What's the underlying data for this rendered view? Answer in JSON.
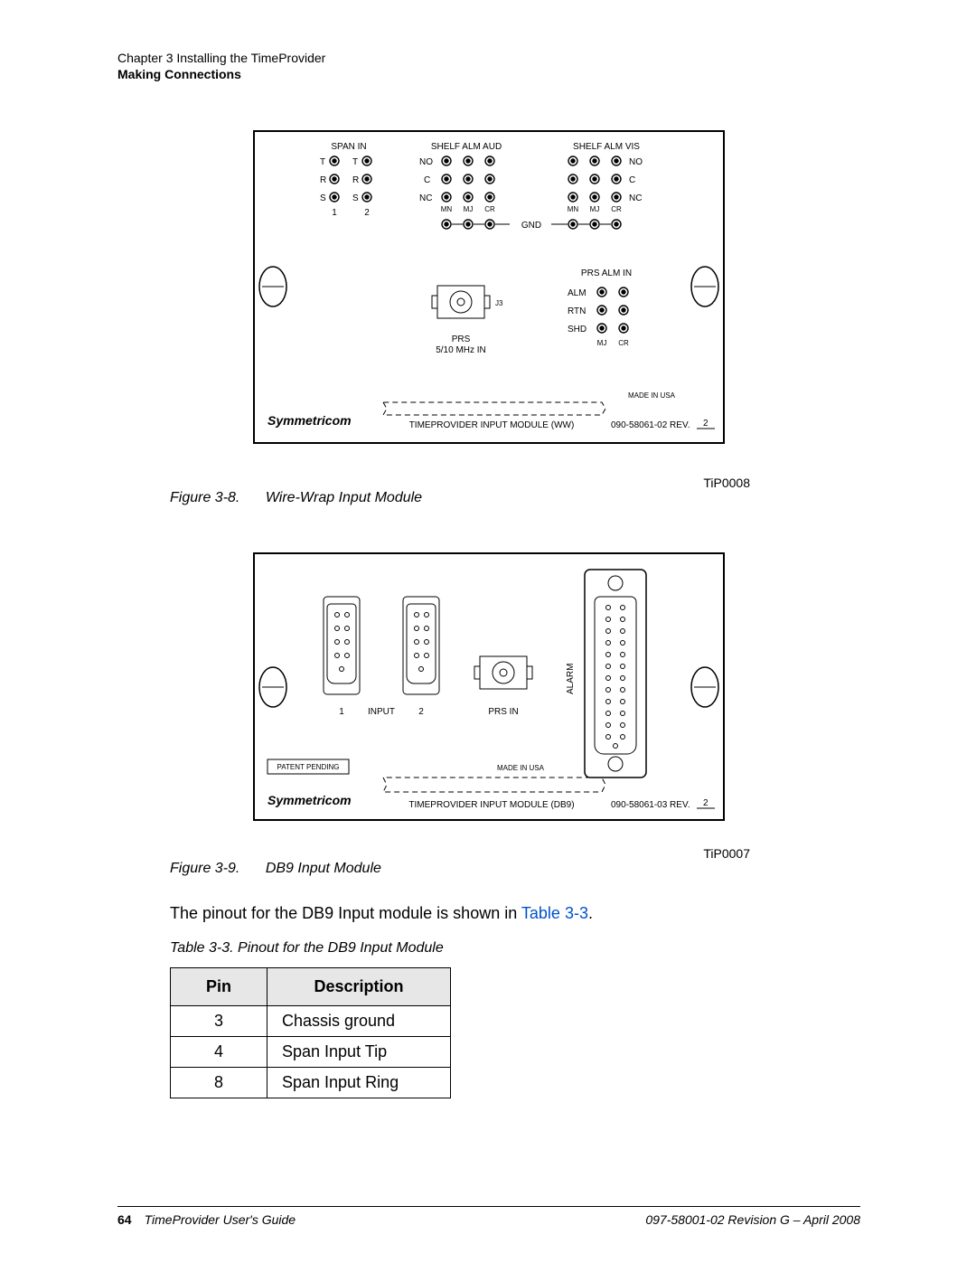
{
  "header": {
    "chapter": "Chapter 3 Installing the TimeProvider",
    "section": "Making Connections"
  },
  "figure_a": {
    "label_num": "Figure 3-8.",
    "label_text": "Wire-Wrap Input Module",
    "tip_code": "TiP0008",
    "panel": {
      "span_in": "SPAN IN",
      "shelf_alm_aud": "SHELF ALM AUD",
      "shelf_alm_vis": "SHELF ALM VIS",
      "rows_trs": [
        "T",
        "R",
        "S"
      ],
      "cols_12": [
        "1",
        "2"
      ],
      "no": "NO",
      "c": "C",
      "nc": "NC",
      "mn": "MN",
      "mj": "MJ",
      "cr": "CR",
      "gnd": "GND",
      "prs_block": "PRS\n5/10 MHz IN",
      "j3": "J3",
      "prs_alm_in": "PRS ALM IN",
      "alm": "ALM",
      "rtn": "RTN",
      "shd": "SHD",
      "brand": "Symmetricom",
      "module_name": "TIMEPROVIDER INPUT MODULE (WW)",
      "made_in": "MADE IN USA",
      "partno": "090-58061-02 REV.",
      "rev": "2"
    }
  },
  "figure_b": {
    "label_num": "Figure 3-9.",
    "label_text": "DB9 Input Module",
    "tip_code": "TiP0007",
    "panel": {
      "input": "INPUT",
      "one": "1",
      "two": "2",
      "prs_in": "PRS IN",
      "alarm": "ALARM",
      "patent": "PATENT PENDING",
      "made_in": "MADE IN USA",
      "brand": "Symmetricom",
      "module_name": "TIMEPROVIDER INPUT MODULE (DB9)",
      "partno": "090-58061-03 REV.",
      "rev": "2"
    }
  },
  "body_text": {
    "pre": "The pinout for the DB9 Input module is shown in ",
    "link": "Table 3-3",
    "post": "."
  },
  "table": {
    "caption": "Table 3-3.  Pinout for the DB9 Input Module",
    "headers": {
      "pin": "Pin",
      "desc": "Description"
    },
    "rows": [
      {
        "pin": "3",
        "desc": "Chassis ground"
      },
      {
        "pin": "4",
        "desc": "Span Input Tip"
      },
      {
        "pin": "8",
        "desc": "Span Input Ring"
      }
    ]
  },
  "footer": {
    "page": "64",
    "doc": "TimeProvider User's Guide",
    "rev": "097-58001-02 Revision G – April 2008"
  }
}
